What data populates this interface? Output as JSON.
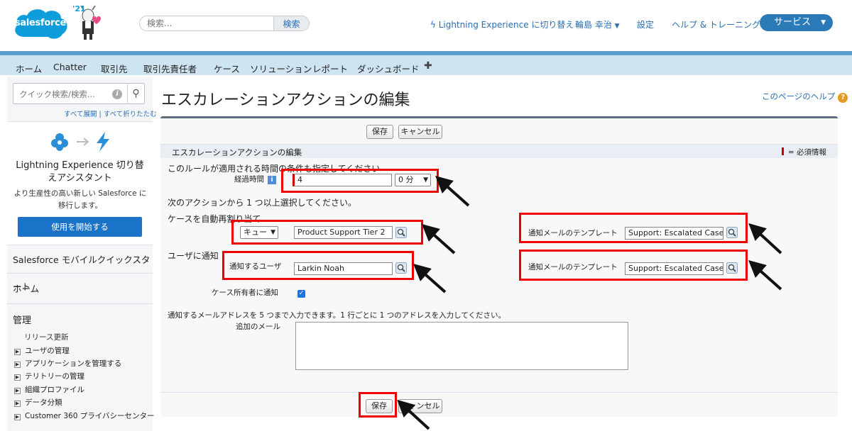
{
  "header": {
    "logo_text": "salesforce",
    "release_badge": "'21",
    "search_placeholder": "検索...",
    "search_button": "検索",
    "lex_link": "Lightning Experience に切り替え",
    "user_name": "輪島 幸治",
    "setup": "設定",
    "help": "ヘルプ & トレーニング",
    "app_switcher": "サービス"
  },
  "tabs": [
    "ホーム",
    "Chatter",
    "取引先",
    "取引先責任者",
    "ケース",
    "ソリューション",
    "レポート",
    "ダッシュボード"
  ],
  "sidebar": {
    "quick_search_placeholder": "クイック検索/検索...",
    "expand_collapse": "すべて展開 | すべて折りたたむ",
    "lex_card_title": "Lightning Experience 切り替えアシスタント",
    "lex_card_desc": "より生産性の高い新しい Salesforce に移行します。",
    "lex_start_button": "使用を開始する",
    "mobile_quickstart": "Salesforce モバイルクイックスタート",
    "home": "ホーム",
    "admin_title": "管理",
    "release_update": "リリース更新",
    "admin_items": [
      "ユーザの管理",
      "アプリケーションを管理する",
      "テリトリーの管理",
      "組織プロファイル",
      "データ分類",
      "Customer 360 プライバシーセンター"
    ]
  },
  "main": {
    "page_title": "エスカレーションアクションの編集",
    "help_link": "このページのヘルプ",
    "save": "保存",
    "cancel": "キャンセル",
    "section_title": "エスカレーションアクションの編集",
    "required_info": "= 必須情報",
    "rule_time_label": "このルールが適用される時間の条件も指定してください",
    "elapsed_label": "経過時間",
    "elapsed_hours": "4",
    "elapsed_minutes": "0 分",
    "action_instruction": "次のアクションから 1 つ以上選択してください。",
    "reassign_label": "ケースを自動再割り当て",
    "queue_type": "キュー",
    "queue_value": "Product Support Tier 2",
    "template_label_1": "通知メールのテンプレート",
    "template_value_1": "Support: Escalated Case",
    "notify_label": "ユーザに通知",
    "notify_user_label": "通知するユーザ",
    "notify_user_value": "Larkin Noah",
    "template_label_2": "通知メールのテンプレート",
    "template_value_2": "Support: Escalated Case",
    "owner_notify_label": "ケース所有者に通知",
    "owner_notify_checked": true,
    "email_instruction": "通知するメールアドレスを 5 つまで入力できます。1 行ごとに 1 つのアドレスを入力してください。",
    "additional_email_label": "追加のメール",
    "additional_email_value": ""
  },
  "colors": {
    "accent": "#2a7ab8",
    "tab_bg": "#cfe4f1",
    "highlight": "#e00000",
    "required": "#cc0000"
  }
}
